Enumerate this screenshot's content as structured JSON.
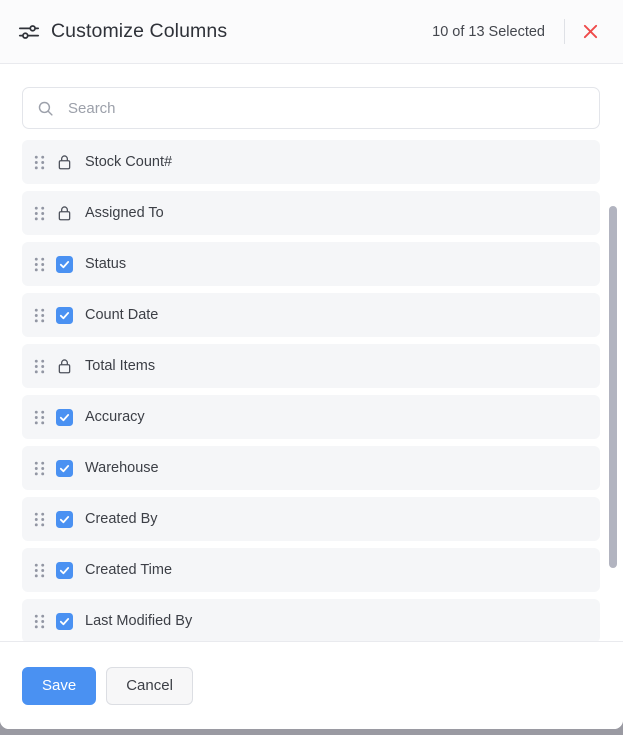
{
  "header": {
    "icon": "sliders-icon",
    "title": "Customize Columns",
    "selected_text": "10 of 13 Selected",
    "close_icon": "close-icon",
    "close_color": "#ef4a4a"
  },
  "search": {
    "icon": "search-icon",
    "placeholder": "Search",
    "value": ""
  },
  "colors": {
    "accent": "#4a91f2",
    "row_bg": "#f5f6f8",
    "text": "#3c3f46",
    "scrollbar": "#b2b4c0"
  },
  "columns": [
    {
      "label": "Stock Count#",
      "state": "locked",
      "icon": "lock-icon"
    },
    {
      "label": "Assigned To",
      "state": "locked",
      "icon": "lock-icon"
    },
    {
      "label": "Status",
      "state": "checked",
      "icon": "checkbox-checked-icon"
    },
    {
      "label": "Count Date",
      "state": "checked",
      "icon": "checkbox-checked-icon"
    },
    {
      "label": "Total Items",
      "state": "locked",
      "icon": "lock-icon"
    },
    {
      "label": "Accuracy",
      "state": "checked",
      "icon": "checkbox-checked-icon"
    },
    {
      "label": "Warehouse",
      "state": "checked",
      "icon": "checkbox-checked-icon"
    },
    {
      "label": "Created By",
      "state": "checked",
      "icon": "checkbox-checked-icon"
    },
    {
      "label": "Created Time",
      "state": "checked",
      "icon": "checkbox-checked-icon"
    },
    {
      "label": "Last Modified By",
      "state": "checked",
      "icon": "checkbox-checked-icon"
    }
  ],
  "footer": {
    "save_label": "Save",
    "cancel_label": "Cancel"
  }
}
